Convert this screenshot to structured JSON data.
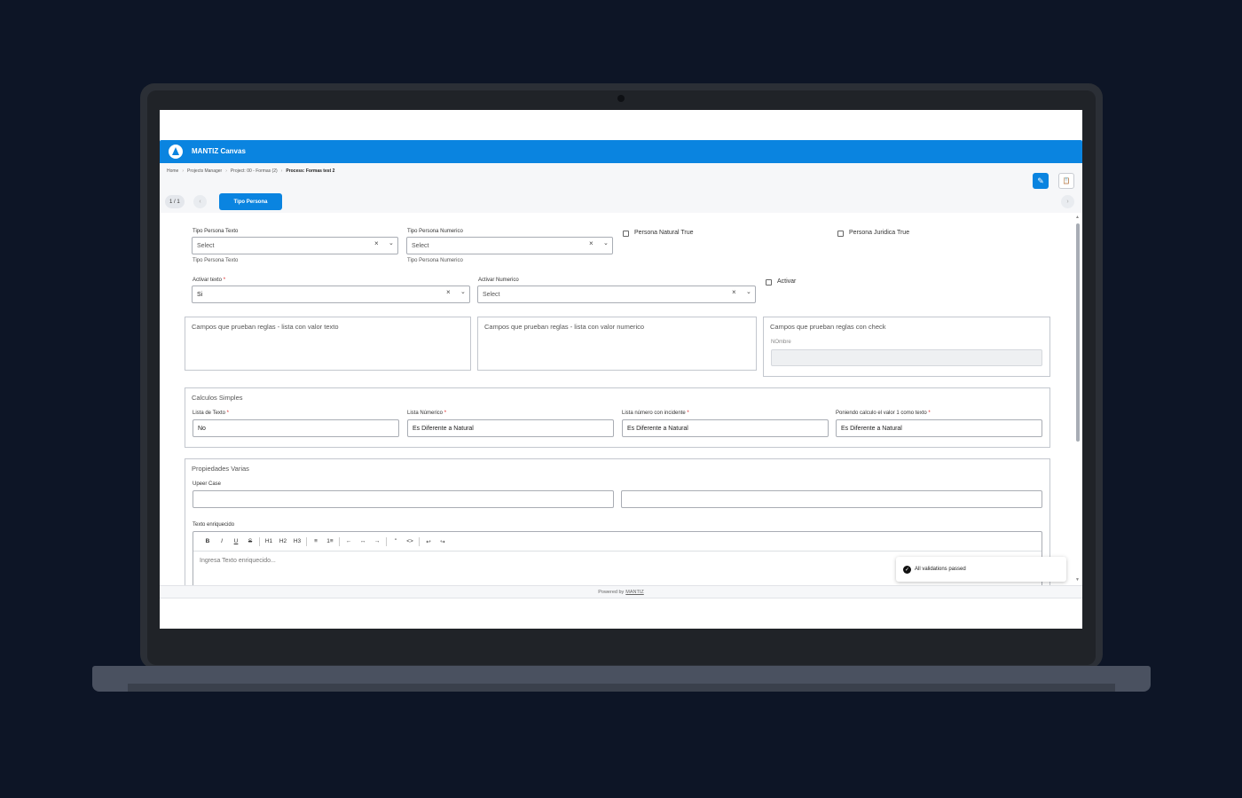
{
  "app": {
    "title": "MANTIZ Canvas"
  },
  "breadcrumb": [
    "Home",
    "Projects Manager",
    "Project: 00 - Formas (2)",
    "Process: Formas test 2"
  ],
  "breadcrumb_separator": "›",
  "pager": {
    "label": "1 / 1",
    "prev": "‹",
    "next": "›"
  },
  "tabs": [
    {
      "label": "Tipo Persona"
    }
  ],
  "row1": {
    "tipo_persona_texto": {
      "label": "Tipo Persona Texto",
      "value": "Select",
      "helper": "Tipo Persona Texto"
    },
    "tipo_persona_numerico": {
      "label": "Tipo Persona Numerico",
      "value": "Select",
      "helper": "Tipo Persona Numerico"
    },
    "persona_natural": {
      "label": "Persona Natural True",
      "checked": false
    },
    "persona_juridica": {
      "label": "Persona Juridica True",
      "checked": false
    }
  },
  "row2": {
    "activar_texto": {
      "label": "Activar texto",
      "required_mark": "*",
      "value": "Si"
    },
    "activar_numerico": {
      "label": "Activar Numerico",
      "value": "Select"
    },
    "activar": {
      "label": "Activar",
      "checked": false
    }
  },
  "clear_glyph": "×",
  "chevron_glyph": "⌄",
  "panels": {
    "lista_texto": {
      "title": "Campos que prueban reglas - lista con valor texto"
    },
    "lista_numerico": {
      "title": "Campos que prueban reglas - lista con valor numerico"
    },
    "check": {
      "title": "Campos que prueban reglas con check",
      "field_label": "NOmbre"
    }
  },
  "calculos": {
    "title": "Calculos Simples",
    "fields": [
      {
        "label": "Lista de Texto",
        "required_mark": "*",
        "value": "No"
      },
      {
        "label": "Lista Númerico",
        "required_mark": "*",
        "value": "Es Diferente a Natural"
      },
      {
        "label": "Lista número con incidente",
        "required_mark": "*",
        "value": "Es Diferente a Natural"
      },
      {
        "label": "Poniendo calculo el valor 1 como texto",
        "required_mark": "*",
        "value": "Es Diferente a Natural"
      }
    ]
  },
  "propiedades": {
    "title": "Propiedades Varias",
    "upper_case_label": "Upeer Case",
    "rich_text_label": "Texto enriquecido",
    "rich_text_placeholder": "Ingresa Texto enriquecido...",
    "toolbar": [
      "B",
      "I",
      "U",
      "S",
      "H1",
      "H2",
      "H3",
      "≡",
      "1≡",
      "←",
      "↔",
      "→",
      "\"",
      "<>",
      "↩",
      "↪"
    ]
  },
  "toast": {
    "message": "All validations passed",
    "icon": "check-circle-icon"
  },
  "footer": {
    "prefix": "Powered by",
    "brand": "MANTIZ"
  },
  "scroll": {
    "up": "▲",
    "down": "▼"
  },
  "icons": {
    "edit": "✎",
    "clipboard": "📋"
  },
  "colors": {
    "primary": "#0a84e0",
    "frame": "#2b2f36",
    "background": "#0d1526"
  }
}
